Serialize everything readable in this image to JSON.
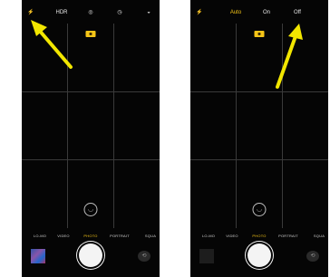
{
  "colors": {
    "accent": "#f5c518",
    "arrow": "#f2e600",
    "background": "#050505"
  },
  "left_screen": {
    "topbar": {
      "flash_icon": "⚡",
      "hdr_label": "HDR",
      "live_icon": "◎",
      "timer_icon": "◷",
      "filter_icon": "◒"
    },
    "mode_labels": [
      "LO-MO",
      "VIDEO",
      "PHOTO",
      "PORTRAIT",
      "SQUA"
    ],
    "active_mode": "PHOTO",
    "live_symbol": "◡",
    "flip_icon": "⟲"
  },
  "right_screen": {
    "topbar": {
      "flash_icon": "⚡",
      "auto_label": "Auto",
      "on_label": "On",
      "off_label": "Off"
    },
    "mode_labels": [
      "LO-MO",
      "VIDEO",
      "PHOTO",
      "PORTRAIT",
      "SQUA"
    ],
    "active_mode": "PHOTO",
    "live_symbol": "◡",
    "flip_icon": "⟲"
  }
}
